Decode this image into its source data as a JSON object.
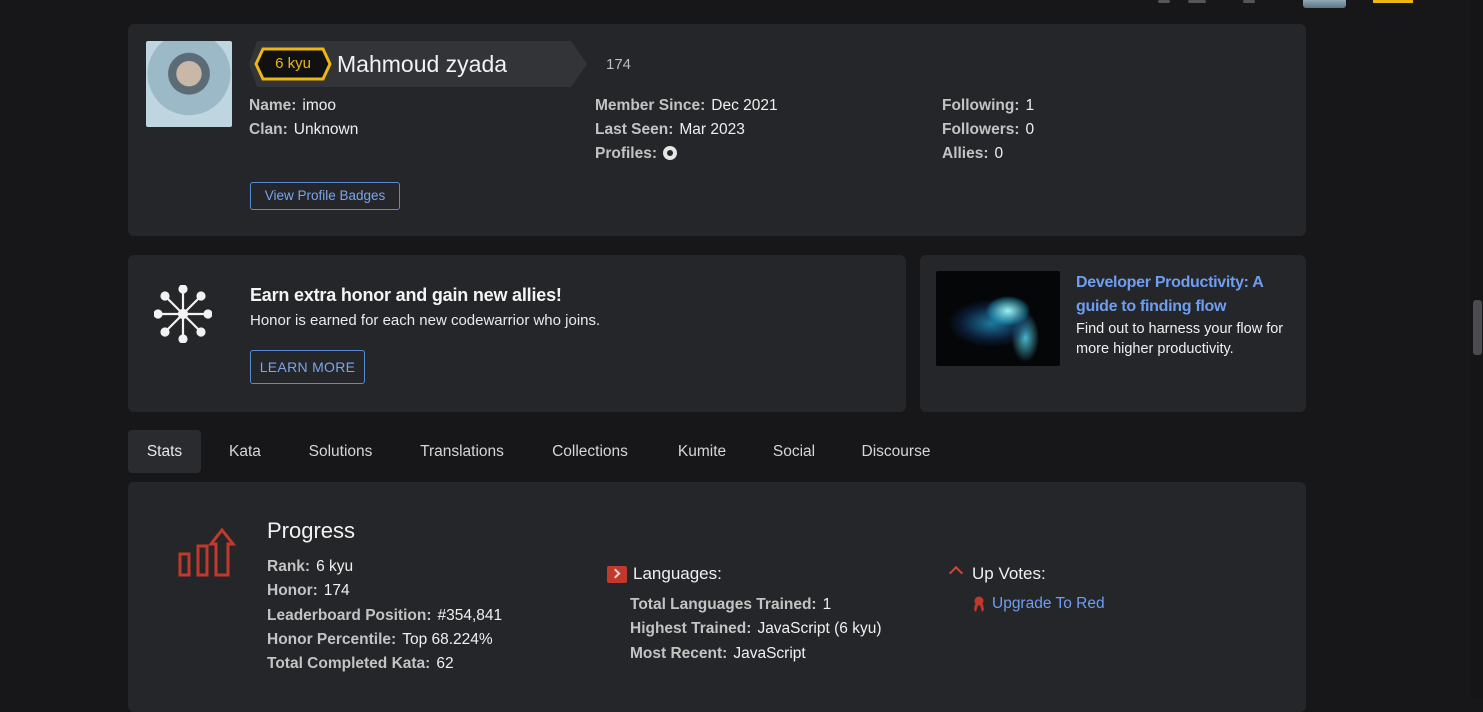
{
  "profile": {
    "rank_badge": "6 kyu",
    "username": "Mahmoud zyada",
    "honor": "174",
    "col1": [
      {
        "label": "Name:",
        "value": "imoo"
      },
      {
        "label": "Clan:",
        "value": "Unknown"
      }
    ],
    "col2": [
      {
        "label": "Member Since:",
        "value": "Dec 2021"
      },
      {
        "label": "Last Seen:",
        "value": "Mar 2023"
      },
      {
        "label": "Profiles:",
        "value": ""
      }
    ],
    "col3": [
      {
        "label": "Following:",
        "value": "1"
      },
      {
        "label": "Followers:",
        "value": "0"
      },
      {
        "label": "Allies:",
        "value": "0"
      }
    ],
    "badges_button": "View Profile Badges",
    "profile_icon": "github-icon"
  },
  "referral": {
    "title": "Earn extra honor and gain new allies!",
    "subtitle": "Honor is earned for each new codewarrior who joins.",
    "button": "LEARN MORE"
  },
  "article": {
    "title": "Developer Productivity: A guide to finding flow",
    "description": "Find out to harness your flow for more higher productivity."
  },
  "tabs": [
    "Stats",
    "Kata",
    "Solutions",
    "Translations",
    "Collections",
    "Kumite",
    "Social",
    "Discourse"
  ],
  "active_tab": "Stats",
  "stats": {
    "progress_title": "Progress",
    "progress": [
      {
        "label": "Rank:",
        "value": "6 kyu"
      },
      {
        "label": "Honor:",
        "value": "174"
      },
      {
        "label": "Leaderboard Position:",
        "value": "#354,841"
      },
      {
        "label": "Honor Percentile:",
        "value": "Top 68.224%"
      },
      {
        "label": "Total Completed Kata:",
        "value": "62"
      }
    ],
    "languages_title": "Languages:",
    "languages": [
      {
        "label": "Total Languages Trained:",
        "value": "1"
      },
      {
        "label": "Highest Trained:",
        "value": "JavaScript (6 kyu)"
      },
      {
        "label": "Most Recent:",
        "value": "JavaScript"
      }
    ],
    "upvotes_title": "Up Votes:",
    "upgrade_link": "Upgrade To Red"
  },
  "colors": {
    "background": "#171719",
    "card": "#252629",
    "accent_yellow": "#ecb613",
    "link_blue": "#6f9ef0",
    "red": "#c0392b"
  }
}
